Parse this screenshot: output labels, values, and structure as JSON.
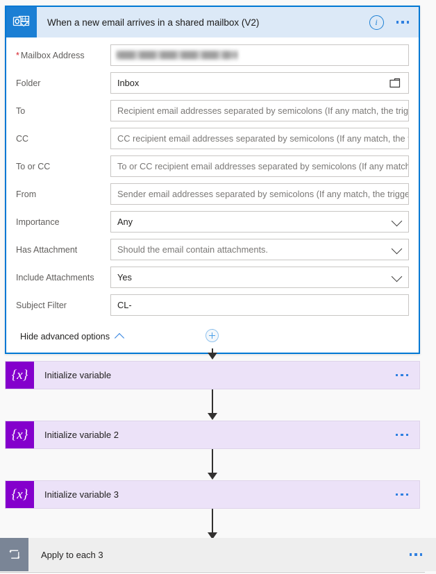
{
  "trigger": {
    "title": "When a new email arrives in a shared mailbox (V2)",
    "icon": "outlook-icon",
    "info_icon": "info-icon",
    "menu_icon": "ellipsis-icon",
    "header_bg": "#dce9f7",
    "icon_bg": "#1b7fd4",
    "border_color": "#0078d4",
    "fields": [
      {
        "label": "Mailbox Address",
        "required": true,
        "required_marker": "*",
        "type": "redacted",
        "value": "",
        "placeholder": ""
      },
      {
        "label": "Folder",
        "required": false,
        "type": "picker",
        "value": "Inbox",
        "placeholder": "",
        "icon": "folder-icon"
      },
      {
        "label": "To",
        "required": false,
        "type": "text",
        "value": "",
        "placeholder": "Recipient email addresses separated by semicolons (If any match, the trigger will fire)"
      },
      {
        "label": "CC",
        "required": false,
        "type": "text",
        "value": "",
        "placeholder": "CC recipient email addresses separated by semicolons (If any match, the trigger will fire)"
      },
      {
        "label": "To or CC",
        "required": false,
        "type": "text",
        "value": "",
        "placeholder": "To or CC recipient email addresses separated by semicolons (If any match, the trigger will fire)"
      },
      {
        "label": "From",
        "required": false,
        "type": "text",
        "value": "",
        "placeholder": "Sender email addresses separated by semicolons (If any match, the trigger will fire)"
      },
      {
        "label": "Importance",
        "required": false,
        "type": "dropdown",
        "value": "Any",
        "placeholder": "",
        "icon": "chevron-down-icon"
      },
      {
        "label": "Has Attachment",
        "required": false,
        "type": "dropdown",
        "value": "",
        "placeholder": "Should the email contain attachments.",
        "icon": "chevron-down-icon"
      },
      {
        "label": "Include Attachments",
        "required": false,
        "type": "dropdown",
        "value": "Yes",
        "placeholder": "",
        "icon": "chevron-down-icon"
      },
      {
        "label": "Subject Filter",
        "required": false,
        "type": "text",
        "value": "CL-",
        "placeholder": ""
      }
    ],
    "advanced_toggle": {
      "label": "Hide advanced options",
      "icon": "chevron-up-icon"
    }
  },
  "connector": {
    "add_button_label": "+",
    "add_button_icon": "plus-icon"
  },
  "actions": [
    {
      "title": "Initialize variable",
      "icon": "variable-icon",
      "icon_glyph": "{x}",
      "icon_bg": "#8400cc",
      "card_bg": "#ece2f8",
      "menu_icon": "ellipsis-icon"
    },
    {
      "title": "Initialize variable 2",
      "icon": "variable-icon",
      "icon_glyph": "{x}",
      "icon_bg": "#8400cc",
      "card_bg": "#ece2f8",
      "menu_icon": "ellipsis-icon"
    },
    {
      "title": "Initialize variable 3",
      "icon": "variable-icon",
      "icon_glyph": "{x}",
      "icon_bg": "#8400cc",
      "card_bg": "#ece2f8",
      "menu_icon": "ellipsis-icon"
    }
  ],
  "scope": {
    "title": "Apply to each 3",
    "icon": "loop-icon",
    "icon_bg": "#7a8596",
    "card_bg": "#eeeeee",
    "menu_icon": "ellipsis-icon"
  }
}
